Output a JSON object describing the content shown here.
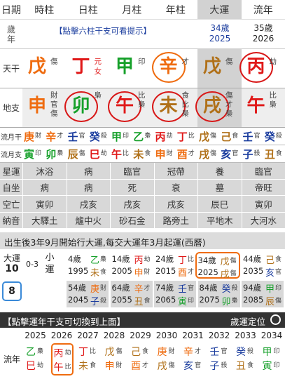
{
  "header": {
    "labels": [
      "日期",
      "時柱",
      "日柱",
      "月柱",
      "年柱",
      "大運",
      "流年"
    ]
  },
  "row2": {
    "label_top": "歲",
    "label_bottom": "年",
    "hint": "【點擊六柱干支可看提示】",
    "dayun_age": "34歲",
    "dayun_year": "2025",
    "liunian_age": "35歲",
    "liunian_year": "2026"
  },
  "tiangan": {
    "label": "天干",
    "cells": [
      {
        "g": "戊",
        "c": "#ef6c10",
        "s": "傷"
      },
      {
        "g": "丁",
        "c": "#e01818",
        "s1": "元",
        "s2": "女"
      },
      {
        "g": "甲",
        "c": "#16a02a",
        "s": "印"
      },
      {
        "g": "辛",
        "c": "#ef6c10",
        "s": "才"
      },
      {
        "g": "戊",
        "c": "#b07018",
        "s": "傷"
      },
      {
        "g": "丙",
        "c": "#e01818",
        "s": "劫"
      }
    ]
  },
  "dizhi": {
    "label": "地支",
    "cells": [
      {
        "g": "申",
        "c": "#ef6c10",
        "s": "財官傷"
      },
      {
        "g": "卯",
        "c": "#16a02a",
        "s": "梟"
      },
      {
        "g": "午",
        "c": "#e01818",
        "s": "比梟"
      },
      {
        "g": "未",
        "c": "#b07018",
        "s": "食比梟"
      },
      {
        "g": "戌",
        "c": "#b07018",
        "s": "傷才梟"
      },
      {
        "g": "午",
        "c": "#e01818",
        "s": "比梟"
      }
    ]
  },
  "liuyue": {
    "label": "流月干",
    "items": [
      [
        "庚",
        "財",
        "#ef6c10"
      ],
      [
        "辛",
        "才",
        "#ef6c10"
      ],
      [
        "壬",
        "官",
        "#1a3c9e"
      ],
      [
        "癸",
        "殺",
        "#1a3c9e"
      ],
      [
        "甲",
        "印",
        "#16a02a"
      ],
      [
        "乙",
        "梟",
        "#16a02a"
      ],
      [
        "丙",
        "劫",
        "#e01818"
      ],
      [
        "丁",
        "比",
        "#e01818"
      ],
      [
        "戊",
        "傷",
        "#b07018"
      ],
      [
        "己",
        "食",
        "#b07018"
      ],
      [
        "壬",
        "官",
        "#1a3c9e"
      ],
      [
        "癸",
        "殺",
        "#1a3c9e"
      ]
    ]
  },
  "liuyue2": {
    "label": "流月支",
    "items": [
      [
        "寅",
        "印",
        "#16a02a"
      ],
      [
        "卯",
        "梟",
        "#16a02a"
      ],
      [
        "辰",
        "傷",
        "#b07018"
      ],
      [
        "巳",
        "劫",
        "#e01818"
      ],
      [
        "午",
        "比",
        "#e01818"
      ],
      [
        "未",
        "食",
        "#b07018"
      ],
      [
        "申",
        "財",
        "#ef6c10"
      ],
      [
        "酉",
        "才",
        "#ef6c10"
      ],
      [
        "戌",
        "傷",
        "#b07018"
      ],
      [
        "亥",
        "官",
        "#1a3c9e"
      ],
      [
        "子",
        "殺",
        "#1a3c9e"
      ],
      [
        "丑",
        "食",
        "#b07018"
      ]
    ]
  },
  "xingyun": {
    "label": "星運",
    "v": [
      "沐浴",
      "病",
      "臨官",
      "冠帶",
      "養",
      "臨官"
    ]
  },
  "zizuo": {
    "label": "自坐",
    "v": [
      "病",
      "病",
      "死",
      "衰",
      "墓",
      "帝旺"
    ]
  },
  "kongwang": {
    "label": "空亡",
    "v": [
      "寅卯",
      "戌亥",
      "戌亥",
      "戌亥",
      "辰巳",
      "寅卯"
    ]
  },
  "nayin": {
    "label": "納音",
    "v": [
      "大驛土",
      "爐中火",
      "砂石金",
      "路旁土",
      "平地木",
      "大河水"
    ]
  },
  "dayun_banner": "出生後3年9月開始行大運,每交大運年3月起運(西曆)",
  "dayun": {
    "label": "大運",
    "num": "10",
    "range": "0-3",
    "xiao": "小運",
    "sel": "8",
    "items": [
      {
        "age": "4歲",
        "year": "1995",
        "g": "乙",
        "gc": "#16a02a",
        "z": "未",
        "zc": "#b07018",
        "gs": "梟",
        "zs": "食"
      },
      {
        "age": "14歲",
        "year": "2005",
        "g": "丙",
        "gc": "#e01818",
        "z": "申",
        "zc": "#ef6c10",
        "gs": "劫",
        "zs": "財"
      },
      {
        "age": "24歲",
        "year": "2015",
        "g": "丁",
        "gc": "#e01818",
        "z": "酉",
        "zc": "#ef6c10",
        "gs": "比",
        "zs": "才"
      },
      {
        "age": "34歲",
        "year": "2025",
        "g": "戊",
        "gc": "#b07018",
        "z": "戌",
        "zc": "#b07018",
        "gs": "傷",
        "zs": "傷"
      },
      {
        "age": "44歲",
        "year": "2035",
        "g": "己",
        "gc": "#b07018",
        "z": "亥",
        "zc": "#1a3c9e",
        "gs": "食",
        "zs": "官"
      },
      {
        "age": "54歲",
        "year": "2045",
        "g": "庚",
        "gc": "#ef6c10",
        "z": "子",
        "zc": "#1a3c9e",
        "gs": "財",
        "zs": "殺"
      },
      {
        "age": "64歲",
        "year": "2055",
        "g": "辛",
        "gc": "#ef6c10",
        "z": "丑",
        "zc": "#b07018",
        "gs": "才",
        "zs": "食"
      },
      {
        "age": "74歲",
        "year": "2065",
        "g": "壬",
        "gc": "#1a3c9e",
        "z": "寅",
        "zc": "#16a02a",
        "gs": "官",
        "zs": "印"
      },
      {
        "age": "84歲",
        "year": "2075",
        "g": "癸",
        "gc": "#1a3c9e",
        "z": "卯",
        "zc": "#16a02a",
        "gs": "殺",
        "zs": "梟"
      },
      {
        "age": "94歲",
        "year": "2085",
        "g": "甲",
        "gc": "#16a02a",
        "z": "辰",
        "zc": "#b07018",
        "gs": "印",
        "zs": "傷"
      }
    ]
  },
  "bar": {
    "left": "【點擊運年干支可切換到上面】",
    "right": "歲運定位"
  },
  "liunian": {
    "label": "流年",
    "years": [
      "2025",
      "2026",
      "2027",
      "2028",
      "2029",
      "2030",
      "2031",
      "2032",
      "2033",
      "2034"
    ],
    "items": [
      [
        "乙",
        "梟",
        "#16a02a",
        "巳",
        "劫",
        "#e01818"
      ],
      [
        "丙",
        "劫",
        "#e01818",
        "午",
        "比",
        "#e01818"
      ],
      [
        "丁",
        "比",
        "#e01818",
        "未",
        "食",
        "#b07018"
      ],
      [
        "戊",
        "傷",
        "#b07018",
        "申",
        "財",
        "#ef6c10"
      ],
      [
        "己",
        "食",
        "#b07018",
        "酉",
        "才",
        "#ef6c10"
      ],
      [
        "庚",
        "財",
        "#ef6c10",
        "戌",
        "傷",
        "#b07018"
      ],
      [
        "辛",
        "才",
        "#ef6c10",
        "亥",
        "官",
        "#1a3c9e"
      ],
      [
        "壬",
        "官",
        "#1a3c9e",
        "子",
        "殺",
        "#1a3c9e"
      ],
      [
        "癸",
        "殺",
        "#1a3c9e",
        "丑",
        "食",
        "#b07018"
      ],
      [
        "甲",
        "印",
        "#16a02a",
        "寅",
        "印",
        "#16a02a"
      ]
    ]
  }
}
